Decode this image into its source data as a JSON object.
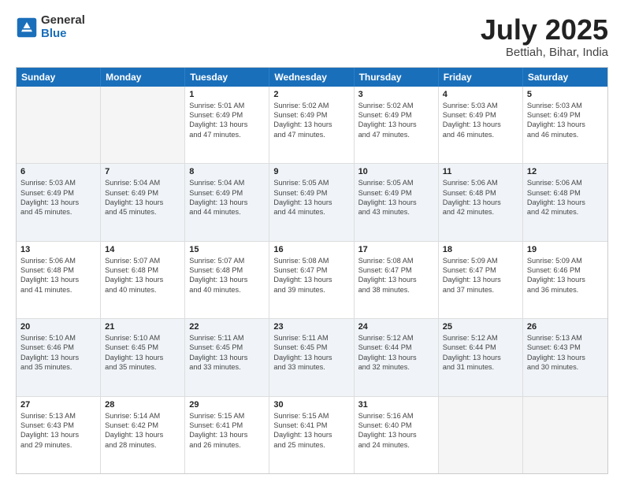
{
  "logo": {
    "text_general": "General",
    "text_blue": "Blue"
  },
  "header": {
    "month_year": "July 2025",
    "location": "Bettiah, Bihar, India"
  },
  "weekdays": [
    "Sunday",
    "Monday",
    "Tuesday",
    "Wednesday",
    "Thursday",
    "Friday",
    "Saturday"
  ],
  "rows": [
    [
      {
        "day": "",
        "lines": []
      },
      {
        "day": "",
        "lines": []
      },
      {
        "day": "1",
        "lines": [
          "Sunrise: 5:01 AM",
          "Sunset: 6:49 PM",
          "Daylight: 13 hours",
          "and 47 minutes."
        ]
      },
      {
        "day": "2",
        "lines": [
          "Sunrise: 5:02 AM",
          "Sunset: 6:49 PM",
          "Daylight: 13 hours",
          "and 47 minutes."
        ]
      },
      {
        "day": "3",
        "lines": [
          "Sunrise: 5:02 AM",
          "Sunset: 6:49 PM",
          "Daylight: 13 hours",
          "and 47 minutes."
        ]
      },
      {
        "day": "4",
        "lines": [
          "Sunrise: 5:03 AM",
          "Sunset: 6:49 PM",
          "Daylight: 13 hours",
          "and 46 minutes."
        ]
      },
      {
        "day": "5",
        "lines": [
          "Sunrise: 5:03 AM",
          "Sunset: 6:49 PM",
          "Daylight: 13 hours",
          "and 46 minutes."
        ]
      }
    ],
    [
      {
        "day": "6",
        "lines": [
          "Sunrise: 5:03 AM",
          "Sunset: 6:49 PM",
          "Daylight: 13 hours",
          "and 45 minutes."
        ]
      },
      {
        "day": "7",
        "lines": [
          "Sunrise: 5:04 AM",
          "Sunset: 6:49 PM",
          "Daylight: 13 hours",
          "and 45 minutes."
        ]
      },
      {
        "day": "8",
        "lines": [
          "Sunrise: 5:04 AM",
          "Sunset: 6:49 PM",
          "Daylight: 13 hours",
          "and 44 minutes."
        ]
      },
      {
        "day": "9",
        "lines": [
          "Sunrise: 5:05 AM",
          "Sunset: 6:49 PM",
          "Daylight: 13 hours",
          "and 44 minutes."
        ]
      },
      {
        "day": "10",
        "lines": [
          "Sunrise: 5:05 AM",
          "Sunset: 6:49 PM",
          "Daylight: 13 hours",
          "and 43 minutes."
        ]
      },
      {
        "day": "11",
        "lines": [
          "Sunrise: 5:06 AM",
          "Sunset: 6:48 PM",
          "Daylight: 13 hours",
          "and 42 minutes."
        ]
      },
      {
        "day": "12",
        "lines": [
          "Sunrise: 5:06 AM",
          "Sunset: 6:48 PM",
          "Daylight: 13 hours",
          "and 42 minutes."
        ]
      }
    ],
    [
      {
        "day": "13",
        "lines": [
          "Sunrise: 5:06 AM",
          "Sunset: 6:48 PM",
          "Daylight: 13 hours",
          "and 41 minutes."
        ]
      },
      {
        "day": "14",
        "lines": [
          "Sunrise: 5:07 AM",
          "Sunset: 6:48 PM",
          "Daylight: 13 hours",
          "and 40 minutes."
        ]
      },
      {
        "day": "15",
        "lines": [
          "Sunrise: 5:07 AM",
          "Sunset: 6:48 PM",
          "Daylight: 13 hours",
          "and 40 minutes."
        ]
      },
      {
        "day": "16",
        "lines": [
          "Sunrise: 5:08 AM",
          "Sunset: 6:47 PM",
          "Daylight: 13 hours",
          "and 39 minutes."
        ]
      },
      {
        "day": "17",
        "lines": [
          "Sunrise: 5:08 AM",
          "Sunset: 6:47 PM",
          "Daylight: 13 hours",
          "and 38 minutes."
        ]
      },
      {
        "day": "18",
        "lines": [
          "Sunrise: 5:09 AM",
          "Sunset: 6:47 PM",
          "Daylight: 13 hours",
          "and 37 minutes."
        ]
      },
      {
        "day": "19",
        "lines": [
          "Sunrise: 5:09 AM",
          "Sunset: 6:46 PM",
          "Daylight: 13 hours",
          "and 36 minutes."
        ]
      }
    ],
    [
      {
        "day": "20",
        "lines": [
          "Sunrise: 5:10 AM",
          "Sunset: 6:46 PM",
          "Daylight: 13 hours",
          "and 35 minutes."
        ]
      },
      {
        "day": "21",
        "lines": [
          "Sunrise: 5:10 AM",
          "Sunset: 6:45 PM",
          "Daylight: 13 hours",
          "and 35 minutes."
        ]
      },
      {
        "day": "22",
        "lines": [
          "Sunrise: 5:11 AM",
          "Sunset: 6:45 PM",
          "Daylight: 13 hours",
          "and 33 minutes."
        ]
      },
      {
        "day": "23",
        "lines": [
          "Sunrise: 5:11 AM",
          "Sunset: 6:45 PM",
          "Daylight: 13 hours",
          "and 33 minutes."
        ]
      },
      {
        "day": "24",
        "lines": [
          "Sunrise: 5:12 AM",
          "Sunset: 6:44 PM",
          "Daylight: 13 hours",
          "and 32 minutes."
        ]
      },
      {
        "day": "25",
        "lines": [
          "Sunrise: 5:12 AM",
          "Sunset: 6:44 PM",
          "Daylight: 13 hours",
          "and 31 minutes."
        ]
      },
      {
        "day": "26",
        "lines": [
          "Sunrise: 5:13 AM",
          "Sunset: 6:43 PM",
          "Daylight: 13 hours",
          "and 30 minutes."
        ]
      }
    ],
    [
      {
        "day": "27",
        "lines": [
          "Sunrise: 5:13 AM",
          "Sunset: 6:43 PM",
          "Daylight: 13 hours",
          "and 29 minutes."
        ]
      },
      {
        "day": "28",
        "lines": [
          "Sunrise: 5:14 AM",
          "Sunset: 6:42 PM",
          "Daylight: 13 hours",
          "and 28 minutes."
        ]
      },
      {
        "day": "29",
        "lines": [
          "Sunrise: 5:15 AM",
          "Sunset: 6:41 PM",
          "Daylight: 13 hours",
          "and 26 minutes."
        ]
      },
      {
        "day": "30",
        "lines": [
          "Sunrise: 5:15 AM",
          "Sunset: 6:41 PM",
          "Daylight: 13 hours",
          "and 25 minutes."
        ]
      },
      {
        "day": "31",
        "lines": [
          "Sunrise: 5:16 AM",
          "Sunset: 6:40 PM",
          "Daylight: 13 hours",
          "and 24 minutes."
        ]
      },
      {
        "day": "",
        "lines": []
      },
      {
        "day": "",
        "lines": []
      }
    ]
  ]
}
